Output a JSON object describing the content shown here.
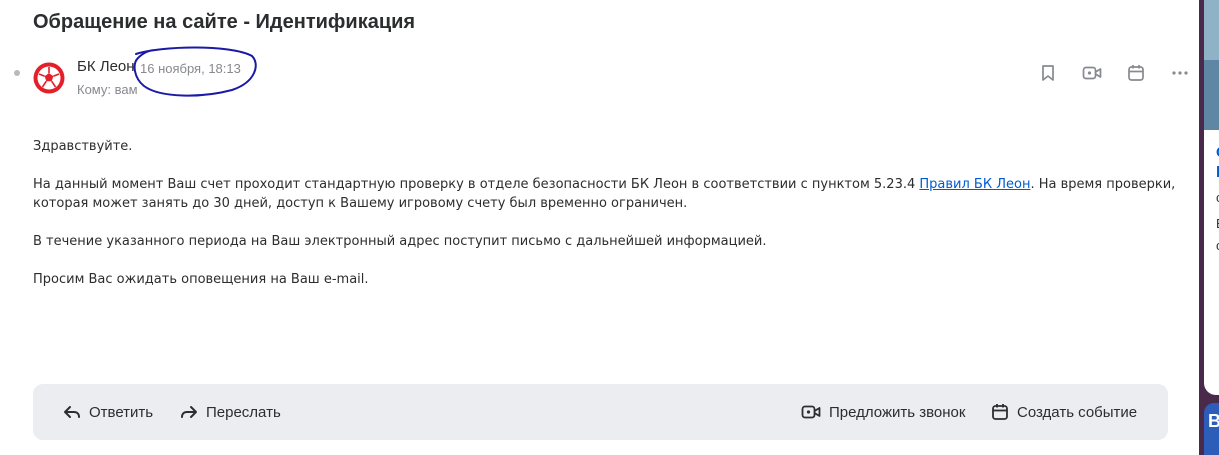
{
  "message": {
    "subject": "Обращение на сайте - Идентификация",
    "sender_name": "БК Леон",
    "date": "16 ноября, 18:13",
    "recipient": "Кому: вам"
  },
  "header_actions": [
    {
      "icon": "bookmark-icon",
      "name": "bookmark-button"
    },
    {
      "icon": "video-call-icon",
      "name": "video-call-button"
    },
    {
      "icon": "calendar-icon",
      "name": "calendar-button"
    },
    {
      "icon": "more-icon",
      "name": "more-button"
    }
  ],
  "body": {
    "greeting": "Здравствуйте.",
    "p1_before_link": "На данный момент Ваш счет проходит стандартную проверку в отделе безопасности БК Леон в соответствии с пунктом 5.23.4 ",
    "p1_link": "Правил БК Леон",
    "p1_after_link": ". На время проверки, которая может занять до 30 дней, доступ к Вашему игровому счету был временно ограничен.",
    "p2": "В течение указанного периода на Ваш электронный адрес поступит письмо с дальнейшей информацией.",
    "p3": "Просим Вас ожидать оповещения на Ваш e-mail."
  },
  "reply_bar": {
    "reply": "Ответить",
    "forward": "Переслать",
    "suggest_call": "Предложить звонок",
    "create_event": "Создать событие"
  },
  "colors": {
    "link": "#005bd1",
    "annotation": "#1a1aa6",
    "avatar_red": "#e3202a",
    "reply_bar_bg": "#ebedf0"
  }
}
